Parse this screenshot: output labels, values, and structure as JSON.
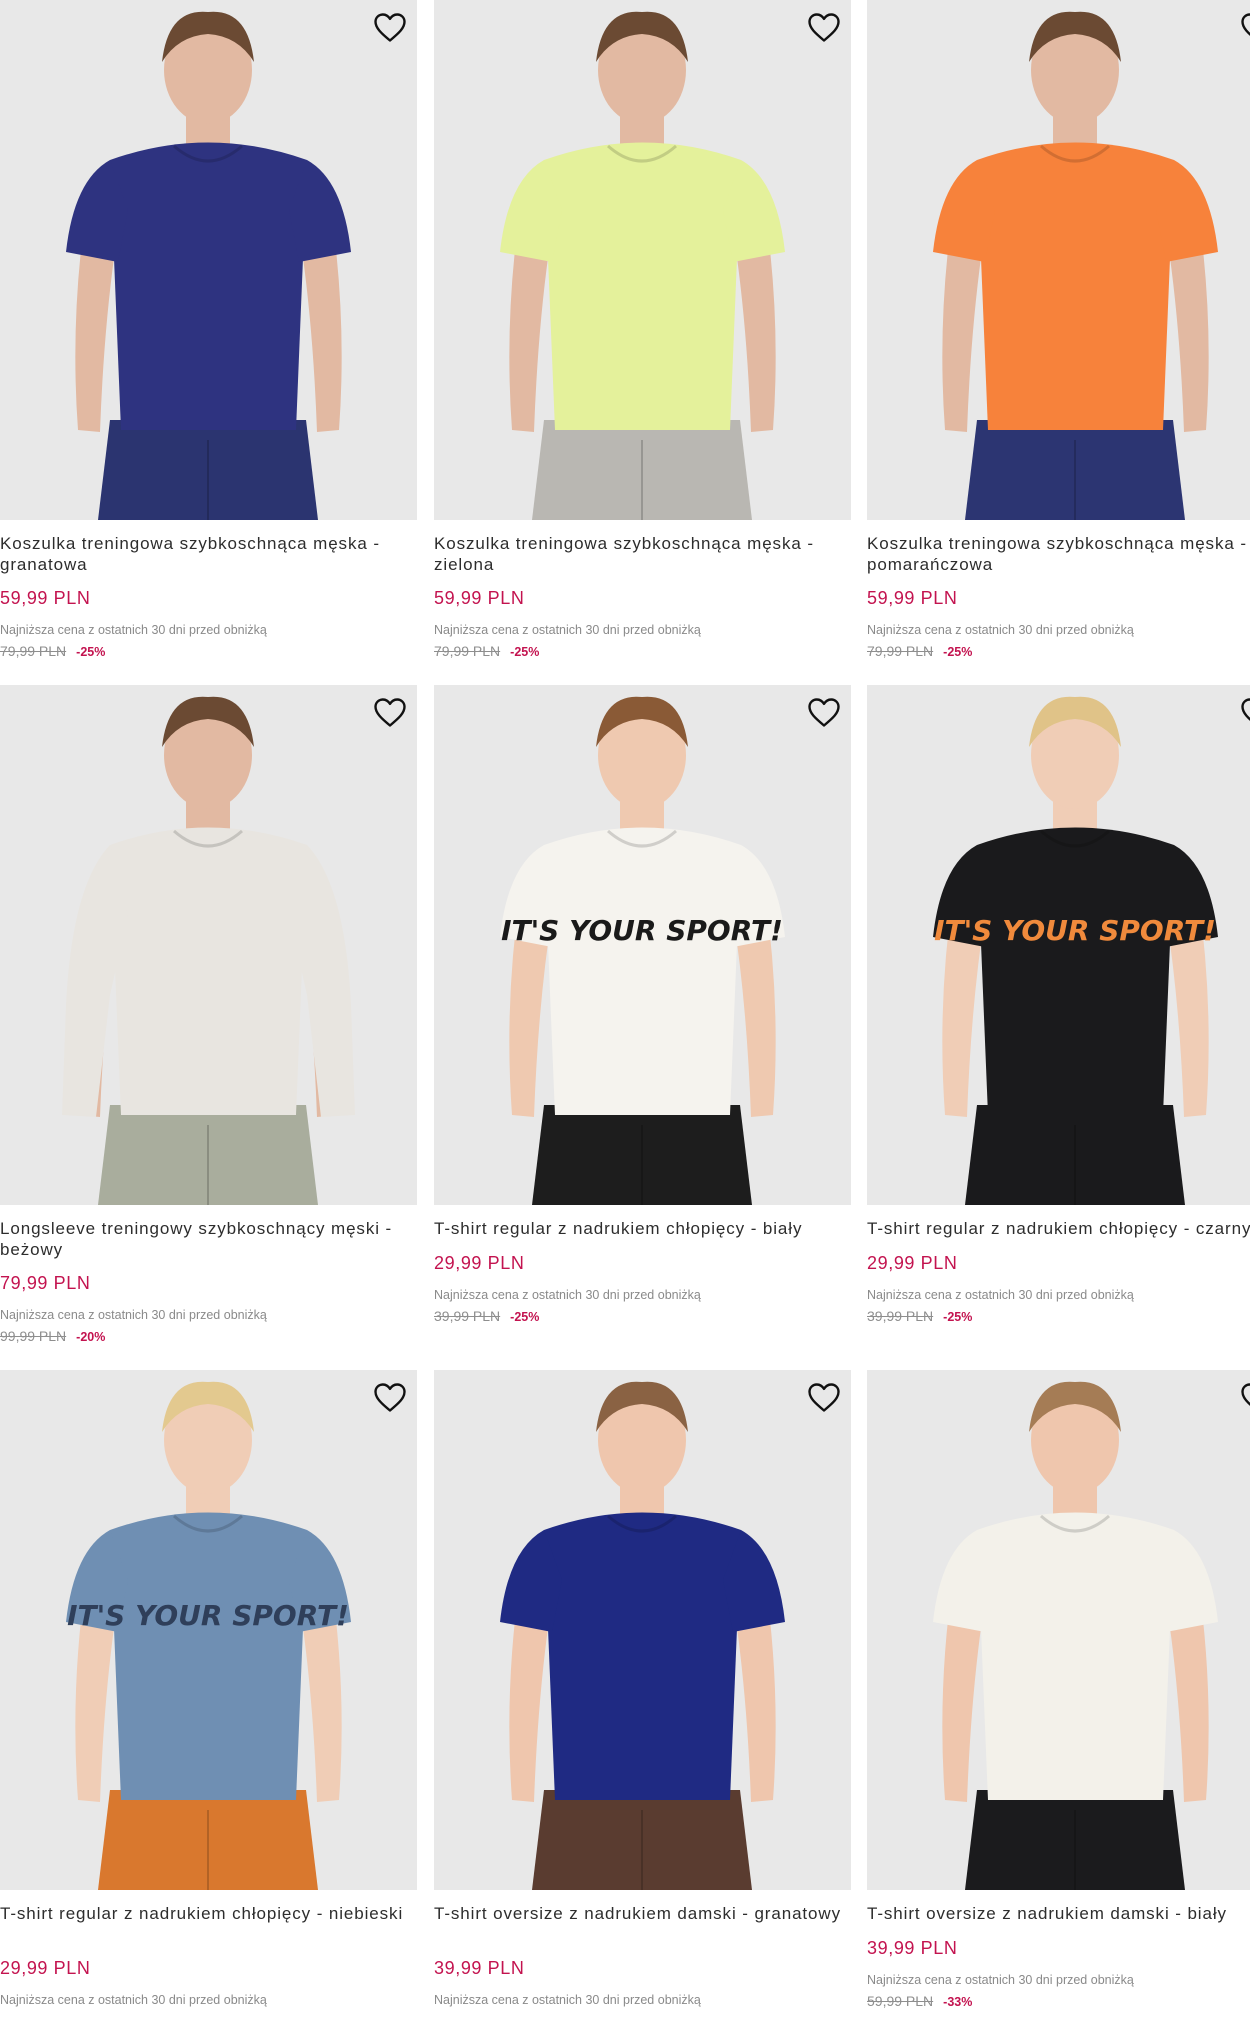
{
  "products": [
    {
      "title": "Koszulka treningowa szybkoschnąca męska - granatowa",
      "price": "59,99 PLN",
      "lowest_price_note": "Najniższa cena z ostatnich 30 dni przed obniżką",
      "old_price": "79,99 PLN",
      "discount": "-25%",
      "image": {
        "shirt": "#2e3380",
        "pants": "#2b3470",
        "skin": "#e2b9a2",
        "hair": "#6b4a33",
        "sleeves": "short",
        "print": "",
        "print_color": ""
      }
    },
    {
      "title": "Koszulka treningowa szybkoschnąca męska - zielona",
      "price": "59,99 PLN",
      "lowest_price_note": "Najniższa cena z ostatnich 30 dni przed obniżką",
      "old_price": "79,99 PLN",
      "discount": "-25%",
      "image": {
        "shirt": "#e4f19b",
        "pants": "#b9b7b2",
        "skin": "#e2b9a2",
        "hair": "#6b4a33",
        "sleeves": "short",
        "print": "",
        "print_color": ""
      }
    },
    {
      "title": "Koszulka treningowa szybkoschnąca męska - pomarańczowa",
      "price": "59,99 PLN",
      "lowest_price_note": "Najniższa cena z ostatnich 30 dni przed obniżką",
      "old_price": "79,99 PLN",
      "discount": "-25%",
      "image": {
        "shirt": "#f7823b",
        "pants": "#2c3572",
        "skin": "#e2b9a2",
        "hair": "#6b4a33",
        "sleeves": "short",
        "print": "",
        "print_color": ""
      }
    },
    {
      "title": "Longsleeve treningowy szybkoschnący męski - beżowy",
      "price": "79,99 PLN",
      "lowest_price_note": "Najniższa cena z ostatnich 30 dni przed obniżką",
      "old_price": "99,99 PLN",
      "discount": "-20%",
      "image": {
        "shirt": "#e8e5e0",
        "pants": "#a9ad9d",
        "skin": "#e2b9a2",
        "hair": "#6b4a33",
        "sleeves": "long",
        "print": "",
        "print_color": ""
      }
    },
    {
      "title": "T-shirt regular z nadrukiem chłopięcy - biały",
      "price": "29,99 PLN",
      "lowest_price_note": "Najniższa cena z ostatnich 30 dni przed obniżką",
      "old_price": "39,99 PLN",
      "discount": "-25%",
      "image": {
        "shirt": "#f5f3ee",
        "pants": "#1d1d1d",
        "skin": "#efc9b0",
        "hair": "#8a5a36",
        "sleeves": "short",
        "print": "IT'S YOUR SPORT!",
        "print_color": "#1a1a1a"
      }
    },
    {
      "title": "T-shirt regular z nadrukiem chłopięcy - czarny",
      "price": "29,99 PLN",
      "lowest_price_note": "Najniższa cena z ostatnich 30 dni przed obniżką",
      "old_price": "39,99 PLN",
      "discount": "-25%",
      "image": {
        "shirt": "#1a1a1c",
        "pants": "#1a1a1c",
        "skin": "#f0cdb6",
        "hair": "#e0c388",
        "sleeves": "short",
        "print": "IT'S YOUR SPORT!",
        "print_color": "#f08a3c"
      }
    },
    {
      "title": "T-shirt regular z nadrukiem chłopięcy - niebieski",
      "price": "29,99 PLN",
      "lowest_price_note": "Najniższa cena z ostatnich 30 dni przed obniżką",
      "old_price": "",
      "discount": "",
      "image": {
        "shirt": "#6f8fb3",
        "pants": "#d9782e",
        "skin": "#f0cdb6",
        "hair": "#e3c98f",
        "sleeves": "short",
        "print": "IT'S YOUR SPORT!",
        "print_color": "#2f3f5a"
      }
    },
    {
      "title": "T-shirt oversize z nadrukiem damski - granatowy",
      "price": "39,99 PLN",
      "lowest_price_note": "Najniższa cena z ostatnich 30 dni przed obniżką",
      "old_price": "",
      "discount": "",
      "image": {
        "shirt": "#1f2a83",
        "pants": "#5a3c30",
        "skin": "#efc6ad",
        "hair": "#8a6243",
        "sleeves": "short",
        "print": "",
        "print_color": ""
      }
    },
    {
      "title": "T-shirt oversize z nadrukiem damski - biały",
      "price": "39,99 PLN",
      "lowest_price_note": "Najniższa cena z ostatnich 30 dni przed obniżką",
      "old_price": "59,99 PLN",
      "discount": "-33%",
      "image": {
        "shirt": "#f3f1ea",
        "pants": "#1b1b1d",
        "skin": "#efc6ad",
        "hair": "#a57c55",
        "sleeves": "short",
        "print": "",
        "print_color": ""
      }
    }
  ]
}
